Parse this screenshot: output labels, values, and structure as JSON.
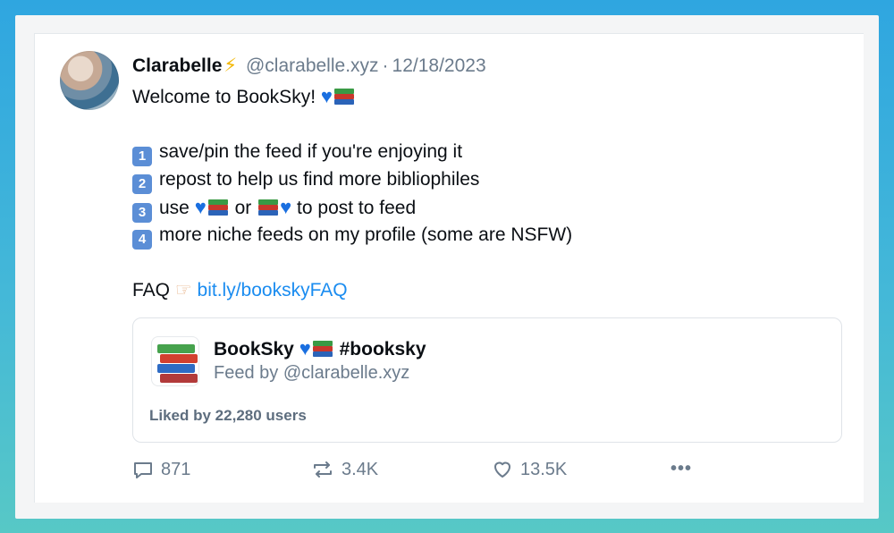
{
  "post": {
    "author_name": "Clarabelle",
    "author_badge": "⚡",
    "handle": "@clarabelle.xyz",
    "separator": "·",
    "date": "12/18/2023",
    "welcome": "Welcome to BookSky!",
    "list": [
      {
        "num": "1",
        "text": "save/pin the feed if you're enjoying it"
      },
      {
        "num": "2",
        "text": "repost to help us find more bibliophiles"
      },
      {
        "num": "3",
        "text_before": "use",
        "text_mid": "or",
        "text_after": "to post to feed"
      },
      {
        "num": "4",
        "text": "more niche feeds on my profile (some are NSFW)"
      }
    ],
    "faq_label": "FAQ",
    "faq_link": "bit.ly/bookskyFAQ"
  },
  "embed": {
    "title": "BookSky",
    "hashtag": "#booksky",
    "subtitle": "Feed by @clarabelle.xyz",
    "liked_by": "Liked by 22,280 users"
  },
  "actions": {
    "replies": "871",
    "reposts": "3.4K",
    "likes": "13.5K",
    "more": "•••"
  },
  "colors": {
    "link": "#1a8cf0",
    "muted": "#6b7b8c",
    "heart": "#1a6fe0"
  }
}
